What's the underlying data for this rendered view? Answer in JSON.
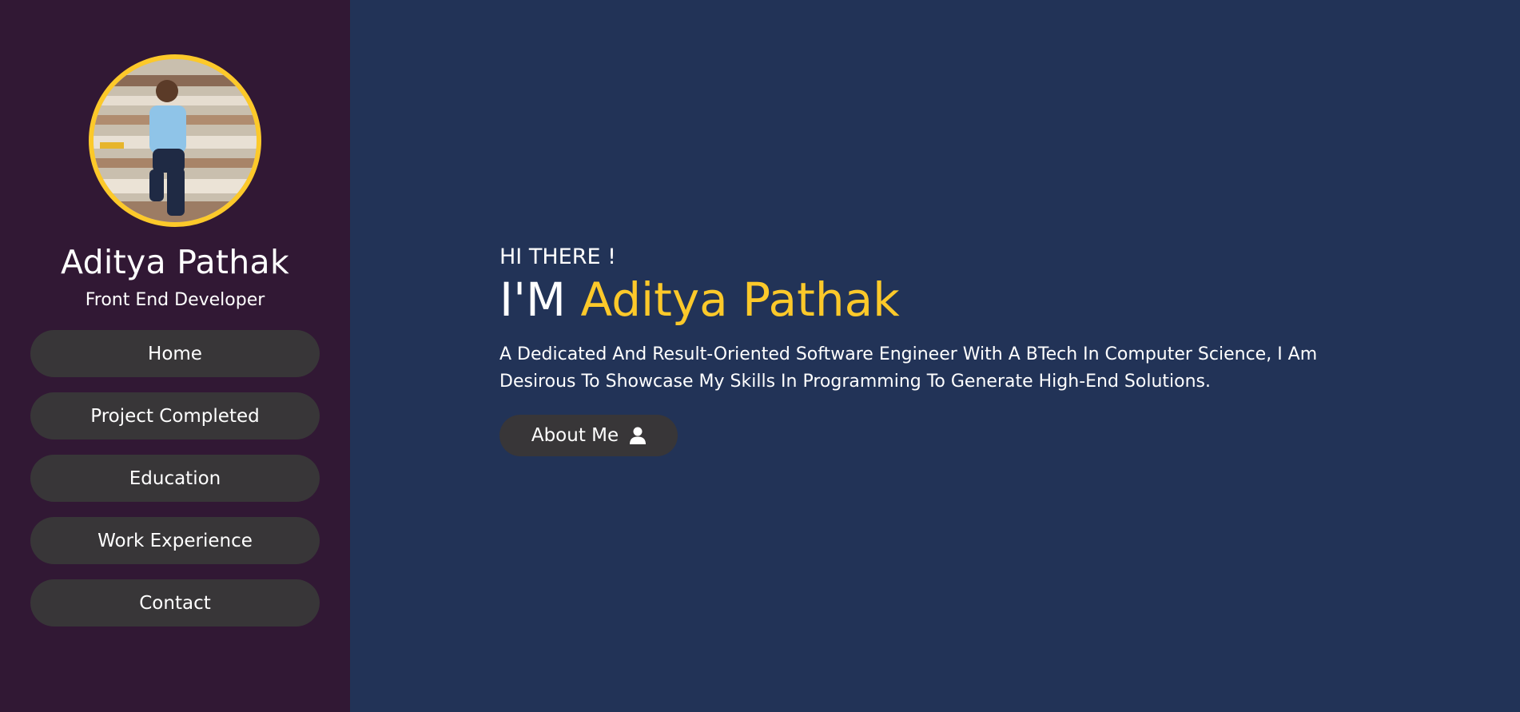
{
  "sidebar": {
    "name": "Aditya Pathak",
    "role": "Front End Developer",
    "items": [
      {
        "label": "Home"
      },
      {
        "label": "Project Completed"
      },
      {
        "label": "Education"
      },
      {
        "label": "Work Experience"
      },
      {
        "label": "Contact"
      }
    ]
  },
  "hero": {
    "greeting": "HI THERE !",
    "prefix": "I'M",
    "name": "Aditya Pathak",
    "bio": "A Dedicated And Result-Oriented Software Engineer With A BTech In Computer Science, I Am Desirous To Showcase My Skills In Programming To Generate High-End Solutions.",
    "button_label": "About Me",
    "button_icon": "user-icon"
  },
  "colors": {
    "sidebar_bg": "#311834",
    "main_bg": "#223357",
    "accent": "#fcc92a",
    "button_bg": "#383638"
  }
}
